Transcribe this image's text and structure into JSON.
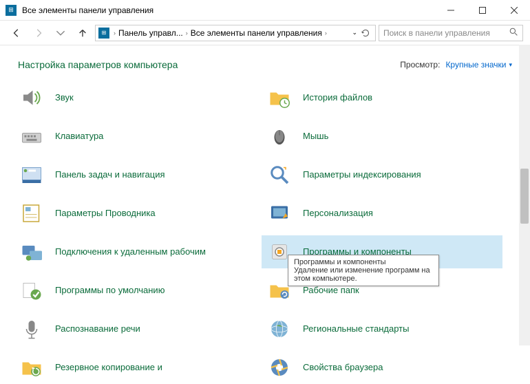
{
  "window": {
    "title": "Все элементы панели управления"
  },
  "breadcrumb": {
    "part1": "Панель управл...",
    "part2": "Все элементы панели управления"
  },
  "search": {
    "placeholder": "Поиск в панели управления"
  },
  "header": {
    "title": "Настройка параметров компьютера"
  },
  "view": {
    "label": "Просмотр:",
    "value": "Крупные значки"
  },
  "items": [
    {
      "label": "Звук",
      "icon": "speaker"
    },
    {
      "label": "История файлов",
      "icon": "folder-history"
    },
    {
      "label": "Клавиатура",
      "icon": "keyboard"
    },
    {
      "label": "Мышь",
      "icon": "mouse"
    },
    {
      "label": "Панель задач и навигация",
      "icon": "taskbar"
    },
    {
      "label": "Параметры индексирования",
      "icon": "indexing"
    },
    {
      "label": "Параметры Проводника",
      "icon": "explorer"
    },
    {
      "label": "Персонализация",
      "icon": "personalize"
    },
    {
      "label": "Подключения к удаленным рабочим",
      "icon": "remote"
    },
    {
      "label": "Программы и компоненты",
      "icon": "programs",
      "selected": true
    },
    {
      "label": "Программы по умолчанию",
      "icon": "defaults"
    },
    {
      "label": "Рабочие папк",
      "icon": "workfolders"
    },
    {
      "label": "Распознавание речи",
      "icon": "speech"
    },
    {
      "label": "Региональные стандарты",
      "icon": "region"
    },
    {
      "label": "Резервное копирование и",
      "icon": "backup"
    },
    {
      "label": "Свойства браузера",
      "icon": "browser"
    }
  ],
  "tooltip": {
    "title": "Программы и компоненты",
    "desc": "Удаление или изменение программ на этом компьютере."
  }
}
